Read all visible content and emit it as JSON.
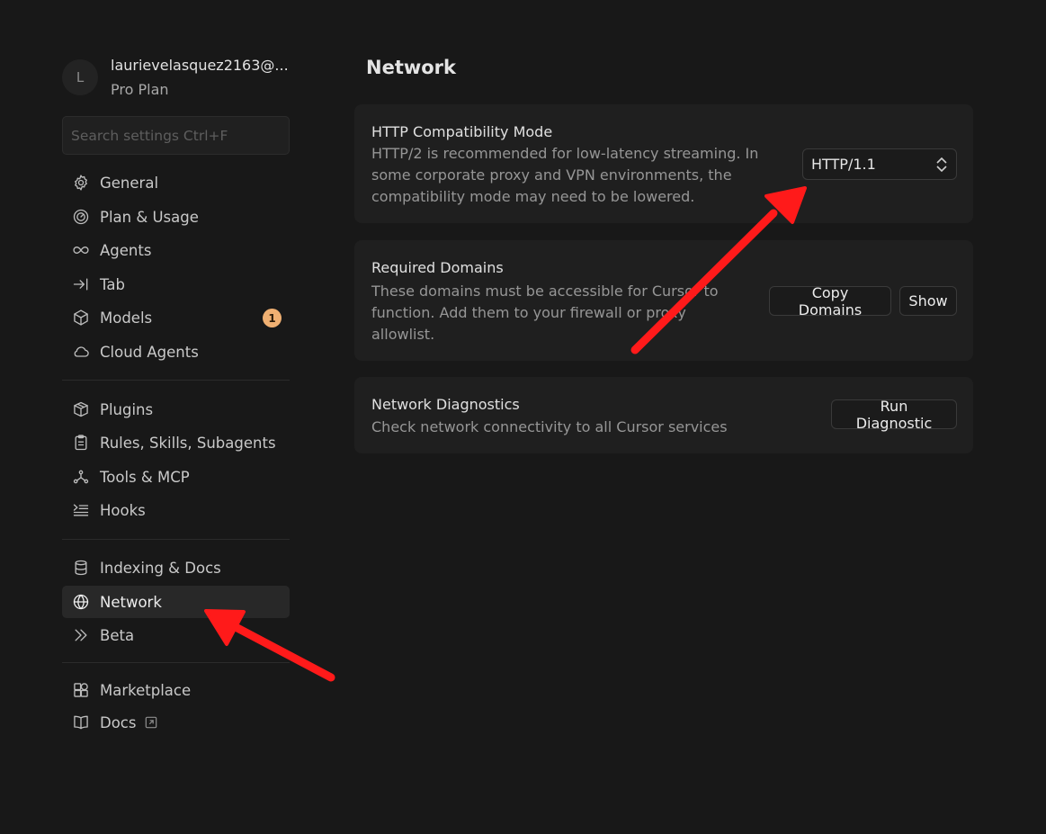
{
  "account": {
    "avatar_letter": "L",
    "email": "laurievelasquez2163@...",
    "plan": "Pro Plan"
  },
  "search": {
    "placeholder": "Search settings Ctrl+F"
  },
  "sidebar": {
    "group1": [
      {
        "label": "General",
        "icon": "gear-icon"
      },
      {
        "label": "Plan & Usage",
        "icon": "gauge-icon"
      },
      {
        "label": "Agents",
        "icon": "infinity-icon"
      },
      {
        "label": "Tab",
        "icon": "arrow-tab-icon"
      },
      {
        "label": "Models",
        "icon": "cube-icon",
        "badge": "1"
      },
      {
        "label": "Cloud Agents",
        "icon": "cloud-icon"
      }
    ],
    "group2": [
      {
        "label": "Plugins",
        "icon": "package-icon"
      },
      {
        "label": "Rules, Skills, Subagents",
        "icon": "clipboard-icon"
      },
      {
        "label": "Tools & MCP",
        "icon": "nodes-icon"
      },
      {
        "label": "Hooks",
        "icon": "hooks-list-icon"
      }
    ],
    "group3": [
      {
        "label": "Indexing & Docs",
        "icon": "database-icon"
      },
      {
        "label": "Network",
        "icon": "globe-icon",
        "active": true
      },
      {
        "label": "Beta",
        "icon": "double-chevron-icon"
      }
    ],
    "group4": [
      {
        "label": "Marketplace",
        "icon": "apps-grid-icon"
      },
      {
        "label": "Docs",
        "icon": "book-icon",
        "external": true
      }
    ]
  },
  "main": {
    "title": "Network",
    "http_mode": {
      "title": "HTTP Compatibility Mode",
      "desc_lines": [
        "HTTP/2 is recommended for low-latency streaming. In",
        "some corporate proxy and VPN environments, the",
        "compatibility mode may need to be lowered."
      ],
      "select_value": "HTTP/1.1"
    },
    "domains": {
      "title": "Required Domains",
      "desc_lines": [
        "These domains must be accessible for Cursor to",
        "function. Add them to your firewall or proxy",
        "allowlist."
      ],
      "copy_label": "Copy Domains",
      "show_label": "Show"
    },
    "diagnostics": {
      "title": "Network Diagnostics",
      "desc": "Check network connectivity to all Cursor services",
      "run_label": "Run Diagnostic"
    }
  },
  "colors": {
    "background": "#181818",
    "card": "#1f1f1f",
    "badge": "#f0b072",
    "annotation_arrow": "#ff1a1a"
  }
}
